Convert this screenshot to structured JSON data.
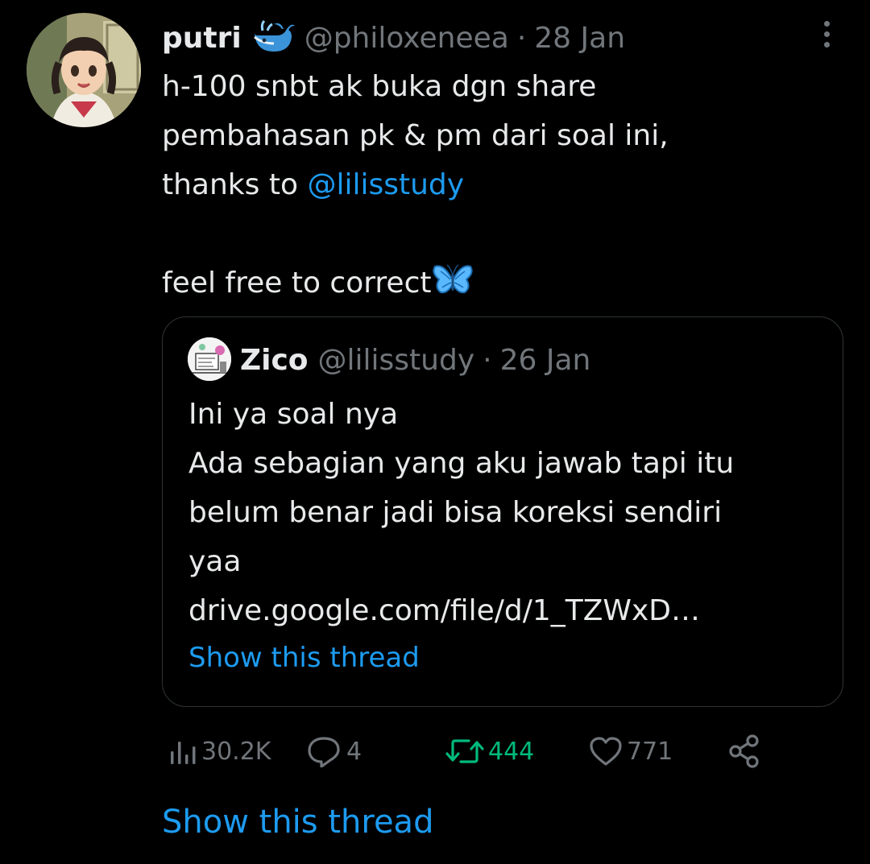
{
  "tweet": {
    "display_name": "putri",
    "badge_icon": "whale-emoji-icon",
    "handle": "@philoxeneea",
    "separator": "·",
    "date": "28 Jan",
    "text_lines": [
      "h-100 snbt ak buka dgn share",
      "pembahasan pk & pm dari soal ini,",
      "thanks to "
    ],
    "mention": "@lilisstudy",
    "last_line": "feel free to correct",
    "emoji": "butterfly-emoji-icon",
    "more_icon": "more-vertical-icon"
  },
  "quote": {
    "display_name": "Zico",
    "handle": "@lilisstudy",
    "separator": "·",
    "date": "26 Jan",
    "text_lines": [
      "Ini ya soal nya",
      "Ada sebagian yang aku jawab tapi itu",
      "belum benar jadi bisa koreksi sendiri",
      "yaa",
      "drive.google.com/file/d/1_TZWxD…"
    ],
    "show_thread": "Show this thread"
  },
  "actions": {
    "views": "30.2K",
    "replies": "4",
    "retweets": "444",
    "likes": "771"
  },
  "show_thread": "Show this thread",
  "colors": {
    "background": "#000000",
    "text": "#e7e9ea",
    "muted": "#71767b",
    "link": "#1d9bf0",
    "retweet": "#00ba7c",
    "border": "#2f3336"
  }
}
